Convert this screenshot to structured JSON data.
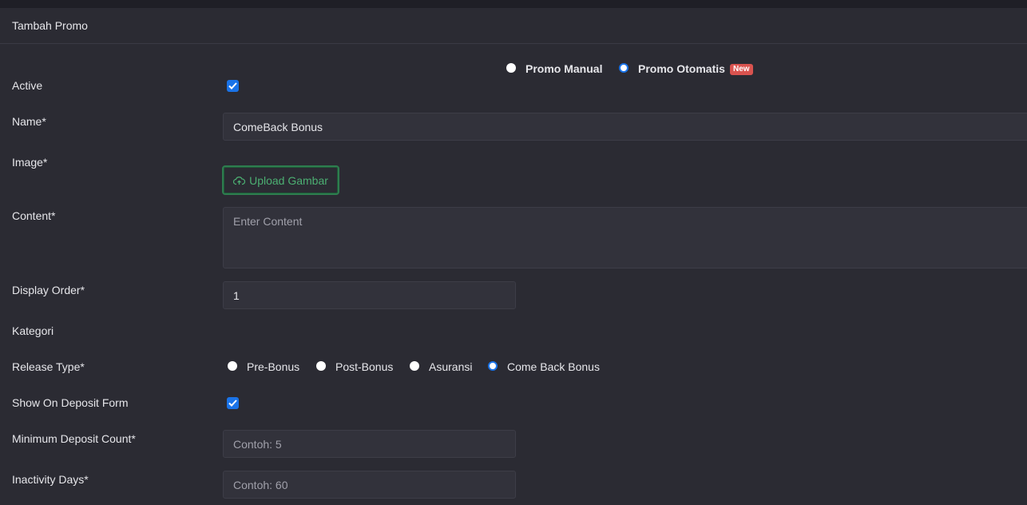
{
  "header": {
    "title": "Tambah Promo"
  },
  "promo_mode": {
    "options": [
      {
        "label": "Promo Manual",
        "checked": false
      },
      {
        "label": "Promo Otomatis",
        "checked": true,
        "badge": "New"
      }
    ]
  },
  "form": {
    "active": {
      "label": "Active",
      "checked": true
    },
    "name": {
      "label": "Name*",
      "value": "ComeBack Bonus"
    },
    "image": {
      "label": "Image*",
      "button_label": "Upload Gambar",
      "button_icon": "cloud-upload-icon"
    },
    "content": {
      "label": "Content*",
      "placeholder": "Enter Content"
    },
    "display_order": {
      "label": "Display Order*",
      "value": "1"
    },
    "kategori": {
      "label": "Kategori"
    },
    "release_type": {
      "label": "Release Type*",
      "options": [
        {
          "label": "Pre-Bonus",
          "checked": false
        },
        {
          "label": "Post-Bonus",
          "checked": false
        },
        {
          "label": "Asuransi",
          "checked": false
        },
        {
          "label": "Come Back Bonus",
          "checked": true
        }
      ]
    },
    "show_on_deposit": {
      "label": "Show On Deposit Form",
      "checked": true
    },
    "min_deposit": {
      "label": "Minimum Deposit Count*",
      "placeholder": "Contoh: 5"
    },
    "inactivity": {
      "label": "Inactivity Days*",
      "placeholder": "Contoh: 60"
    }
  },
  "colors": {
    "accent": "#1a73e8",
    "upload": "#4caf72",
    "badge": "#d9534f"
  }
}
